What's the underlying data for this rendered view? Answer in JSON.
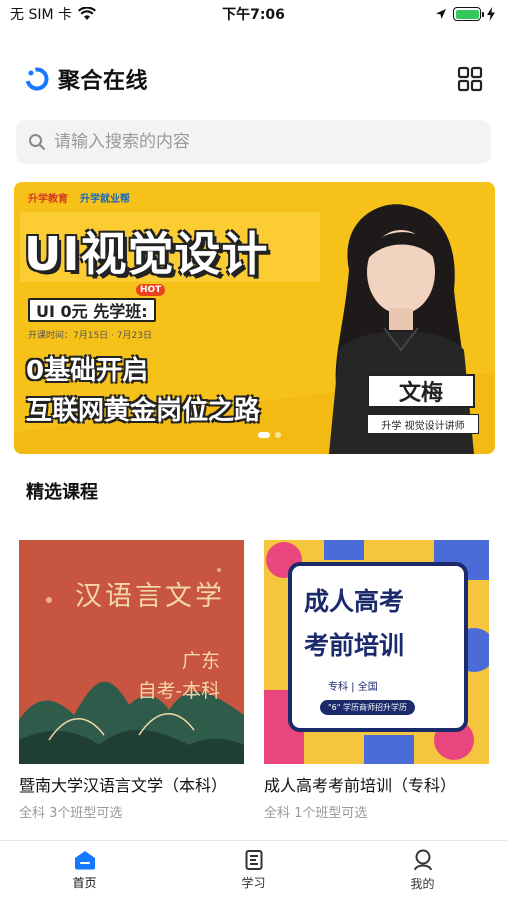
{
  "status_bar": {
    "carrier": "无 SIM 卡",
    "time": "下午7:06"
  },
  "header": {
    "title": "聚合在线",
    "logo_icon": "brand-ring-icon",
    "menu_icon": "grid-icon"
  },
  "search": {
    "placeholder": "请输入搜索的内容"
  },
  "banner": {
    "brand_1": "升学教育",
    "brand_2": "升学就业帮",
    "headline": "UI视觉设计",
    "hot": "HOT",
    "badge": "UI 0元 先学班:",
    "dates": "开课时间：7月15日 · 7月23日",
    "line_1": "0基础开启",
    "line_2": "互联网黄金岗位之路",
    "teacher_name": "文梅",
    "teacher_title": "升学 视觉设计讲师",
    "slide_count": 2,
    "active_slide": 1
  },
  "section": {
    "title": "精选课程"
  },
  "courses": [
    {
      "thumb_title": "汉语言文学",
      "thumb_sub_1": "广东",
      "thumb_sub_2": "自考-本科",
      "name": "暨南大学汉语言文学（本科）",
      "meta": "全科  3个班型可选"
    },
    {
      "thumb_title_1": "成人高考",
      "thumb_title_2": "考前培训",
      "thumb_meta": "专科  |  全国",
      "thumb_tag": "\"6\" 学历商师招升学历",
      "name": "成人高考考前培训（专科）",
      "meta": "全科  1个班型可选"
    }
  ],
  "tabbar": {
    "items": [
      {
        "label": "首页",
        "icon": "home-icon",
        "active": true
      },
      {
        "label": "学习",
        "icon": "document-icon",
        "active": false
      },
      {
        "label": "我的",
        "icon": "user-icon",
        "active": false
      }
    ]
  },
  "colors": {
    "accent": "#1677ff",
    "banner_yellow": "#f6c21a",
    "thumb_red": "#c7553f"
  }
}
